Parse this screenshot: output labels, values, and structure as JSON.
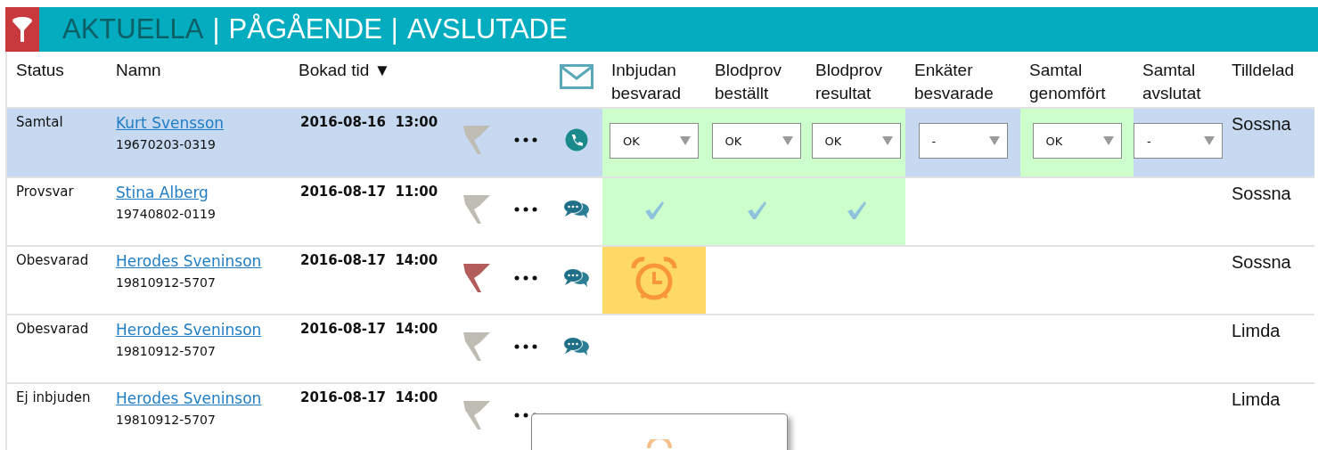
{
  "tabs": [
    {
      "label": "AKTUELLA",
      "selected": true
    },
    {
      "label": "PÅGÅENDE",
      "selected": false
    },
    {
      "label": "AVSLUTADE",
      "selected": false
    }
  ],
  "tab_separators": [
    "|",
    "|"
  ],
  "columns": [
    "Status",
    "Namn",
    "Bokad tid",
    "Inbjudan besvarad",
    "Blodprov beställt",
    "Blodprov resultat",
    "Enkäter besvarade",
    "Samtal genomfört",
    "Samtal avslutat",
    "Tilldelad"
  ],
  "sort_arrow": "▼",
  "rows": [
    {
      "status": "Samtal",
      "name": "Kurt Svensson",
      "id": "19670203-0319",
      "time": "2016-08-16  13:00",
      "selected": true,
      "flagged": false,
      "contact": {
        "kind": "phone"
      },
      "assignee": "Sossna",
      "steps": [
        {
          "kind": "select",
          "value": "OK",
          "done": true
        },
        {
          "kind": "select",
          "value": "OK",
          "done": true
        },
        {
          "kind": "select",
          "value": "OK",
          "done": true
        },
        {
          "kind": "select",
          "value": "-",
          "done": false
        },
        {
          "kind": "select",
          "value": "OK",
          "done": true
        },
        {
          "kind": "select",
          "value": "-",
          "done": false
        }
      ]
    },
    {
      "status": "Provsvar",
      "name": "Stina Alberg",
      "id": "19740802-0119",
      "time": "2016-08-17  11:00",
      "selected": false,
      "flagged": false,
      "contact": {
        "kind": "chat"
      },
      "assignee": "Sossna",
      "steps": [
        {
          "kind": "check",
          "done": true
        },
        {
          "kind": "check",
          "done": true
        },
        {
          "kind": "check",
          "done": true
        },
        {
          "kind": "empty",
          "done": false
        },
        {
          "kind": "empty",
          "done": false
        },
        {
          "kind": "empty",
          "done": false
        }
      ]
    },
    {
      "status": "Obesvarad",
      "name": "Herodes Sveninson",
      "id": "19810912-5707",
      "time": "2016-08-17  14:00",
      "selected": false,
      "flagged": true,
      "contact": {
        "kind": "chat"
      },
      "assignee": "Sossna",
      "steps": [
        {
          "kind": "alarm"
        },
        {
          "kind": "empty",
          "done": false
        },
        {
          "kind": "empty",
          "done": false
        },
        {
          "kind": "empty",
          "done": false
        },
        {
          "kind": "empty",
          "done": false
        },
        {
          "kind": "empty",
          "done": false
        }
      ]
    },
    {
      "status": "Obesvarad",
      "name": "Herodes Sveninson",
      "id": "19810912-5707",
      "time": "2016-08-17  14:00",
      "selected": false,
      "flagged": false,
      "contact": {
        "kind": "chat"
      },
      "assignee": "Limda",
      "steps": [
        {
          "kind": "empty",
          "done": false
        },
        {
          "kind": "empty",
          "done": false
        },
        {
          "kind": "empty",
          "done": false
        },
        {
          "kind": "empty",
          "done": false
        },
        {
          "kind": "empty",
          "done": false
        },
        {
          "kind": "empty",
          "done": false
        }
      ]
    },
    {
      "status": "Ej inbjuden",
      "name": "Herodes Sveninson",
      "id": "19810912-5707",
      "time": "2016-08-17  14:00",
      "selected": false,
      "flagged": false,
      "assignee": "Limda",
      "steps": [
        {
          "kind": "empty",
          "done": false
        },
        {
          "kind": "empty",
          "done": false
        },
        {
          "kind": "empty",
          "done": false
        },
        {
          "kind": "empty",
          "done": false
        },
        {
          "kind": "empty",
          "done": false
        },
        {
          "kind": "empty",
          "done": false
        }
      ]
    }
  ]
}
